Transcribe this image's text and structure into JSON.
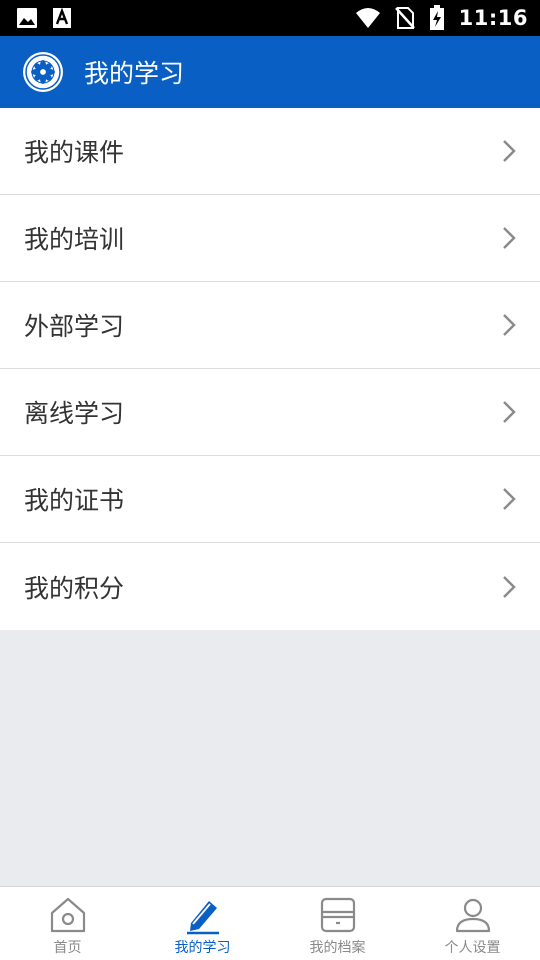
{
  "status_bar": {
    "time": "11:16",
    "icons_left": [
      "image-icon",
      "a-font-icon"
    ],
    "icons_right": [
      "wifi-icon",
      "no-sim-icon",
      "battery-charging-icon"
    ]
  },
  "header": {
    "title": "我的学习",
    "logo": "emblem-logo",
    "background": "#0a5fc4"
  },
  "menu": {
    "items": [
      {
        "label": "我的课件"
      },
      {
        "label": "我的培训"
      },
      {
        "label": "外部学习"
      },
      {
        "label": "离线学习"
      },
      {
        "label": "我的证书"
      },
      {
        "label": "我的积分"
      }
    ]
  },
  "bottom_nav": {
    "active_color": "#0a5fc4",
    "inactive_color": "#8a8a8a",
    "items": [
      {
        "label": "首页",
        "icon": "home-icon",
        "active": false
      },
      {
        "label": "我的学习",
        "icon": "pen-icon",
        "active": true
      },
      {
        "label": "我的档案",
        "icon": "archive-icon",
        "active": false
      },
      {
        "label": "个人设置",
        "icon": "person-icon",
        "active": false
      }
    ]
  }
}
